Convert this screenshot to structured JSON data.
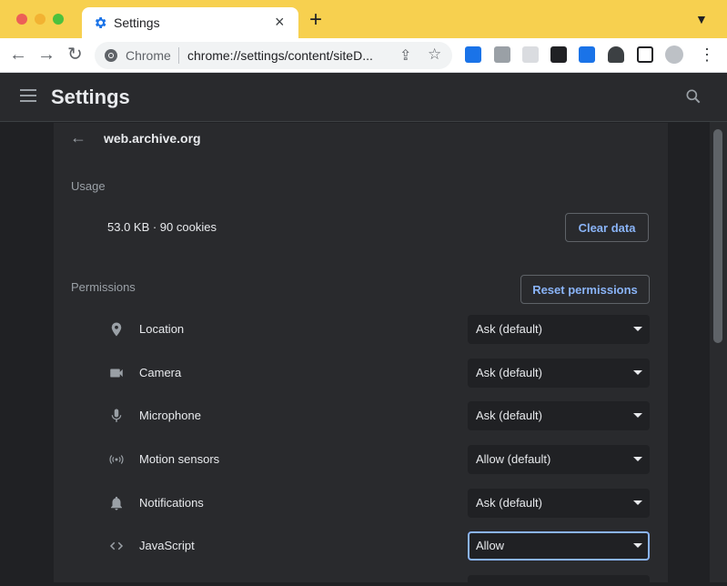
{
  "browser": {
    "tab_title": "Settings",
    "omnibox_chrome_label": "Chrome",
    "omnibox_url": "chrome://settings/content/siteD..."
  },
  "header": {
    "title": "Settings"
  },
  "site": {
    "name": "web.archive.org"
  },
  "usage": {
    "label": "Usage",
    "summary": "53.0 KB · 90 cookies",
    "clear_button": "Clear data"
  },
  "permissions": {
    "label": "Permissions",
    "reset_button": "Reset permissions",
    "items": [
      {
        "label": "Location",
        "value": "Ask (default)",
        "icon": "location-pin-icon"
      },
      {
        "label": "Camera",
        "value": "Ask (default)",
        "icon": "camera-icon"
      },
      {
        "label": "Microphone",
        "value": "Ask (default)",
        "icon": "microphone-icon"
      },
      {
        "label": "Motion sensors",
        "value": "Allow (default)",
        "icon": "motion-sensors-icon"
      },
      {
        "label": "Notifications",
        "value": "Ask (default)",
        "icon": "bell-icon"
      },
      {
        "label": "JavaScript",
        "value": "Allow",
        "icon": "code-icon"
      }
    ]
  },
  "colors": {
    "tab_strip": "#f7d04f",
    "page_bg": "#202124",
    "card_bg": "#292a2d",
    "accent": "#8ab4f8"
  }
}
